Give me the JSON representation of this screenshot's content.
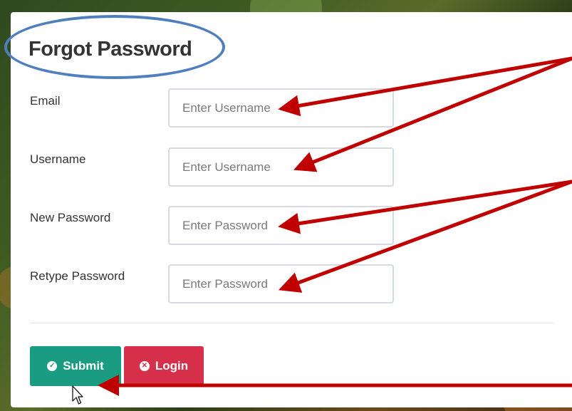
{
  "form": {
    "title": "Forgot Password",
    "fields": [
      {
        "label": "Email",
        "placeholder": "Enter Username",
        "value": ""
      },
      {
        "label": "Username",
        "placeholder": "Enter Username",
        "value": ""
      },
      {
        "label": "New Password",
        "placeholder": "Enter Password",
        "value": ""
      },
      {
        "label": "Retype Password",
        "placeholder": "Enter Password",
        "value": ""
      }
    ],
    "submit_label": "Submit",
    "login_label": "Login"
  },
  "icons": {
    "submit": "check-circle-icon",
    "login": "x-circle-icon"
  },
  "colors": {
    "submit_bg": "#1a9c82",
    "login_bg": "#d6304a",
    "annotation_arrow": "#c00000",
    "annotation_circle": "#4f7fbf"
  }
}
